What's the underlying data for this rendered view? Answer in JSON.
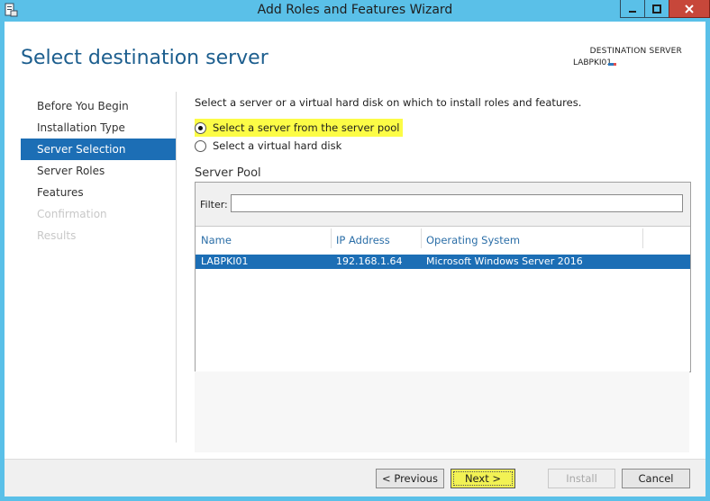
{
  "window": {
    "title": "Add Roles and Features Wizard",
    "icon": "server-manager-icon",
    "controls": [
      "minimize-icon",
      "maximize-icon",
      "close-icon"
    ],
    "accent_color": "#5ac0e8",
    "close_color": "#c7473a"
  },
  "header": {
    "page_title": "Select destination server",
    "destination_label": "DESTINATION SERVER",
    "destination_value": "LABPKI01"
  },
  "nav": {
    "items": [
      {
        "label": "Before You Begin",
        "state": "normal"
      },
      {
        "label": "Installation Type",
        "state": "normal"
      },
      {
        "label": "Server Selection",
        "state": "active"
      },
      {
        "label": "Server Roles",
        "state": "normal"
      },
      {
        "label": "Features",
        "state": "normal"
      },
      {
        "label": "Confirmation",
        "state": "disabled"
      },
      {
        "label": "Results",
        "state": "disabled"
      }
    ],
    "active_color": "#1c6eb5"
  },
  "main": {
    "intro": "Select a server or a virtual hard disk on which to install roles and features.",
    "options": [
      {
        "label": "Select a server from the server pool",
        "checked": true
      },
      {
        "label": "Select a virtual hard disk",
        "checked": false
      }
    ],
    "highlight_color": "#fcfc46",
    "pool": {
      "title": "Server Pool",
      "filter_label": "Filter:",
      "filter_value": "",
      "columns": [
        "Name",
        "IP Address",
        "Operating System"
      ],
      "rows": [
        {
          "name": "LABPKI01",
          "ip": "192.168.1.64",
          "os": "Microsoft Windows Server 2016",
          "selected": true
        }
      ]
    }
  },
  "footer": {
    "previous_label": "< Previous",
    "next_label": "Next >",
    "install_label": "Install",
    "cancel_label": "Cancel"
  }
}
